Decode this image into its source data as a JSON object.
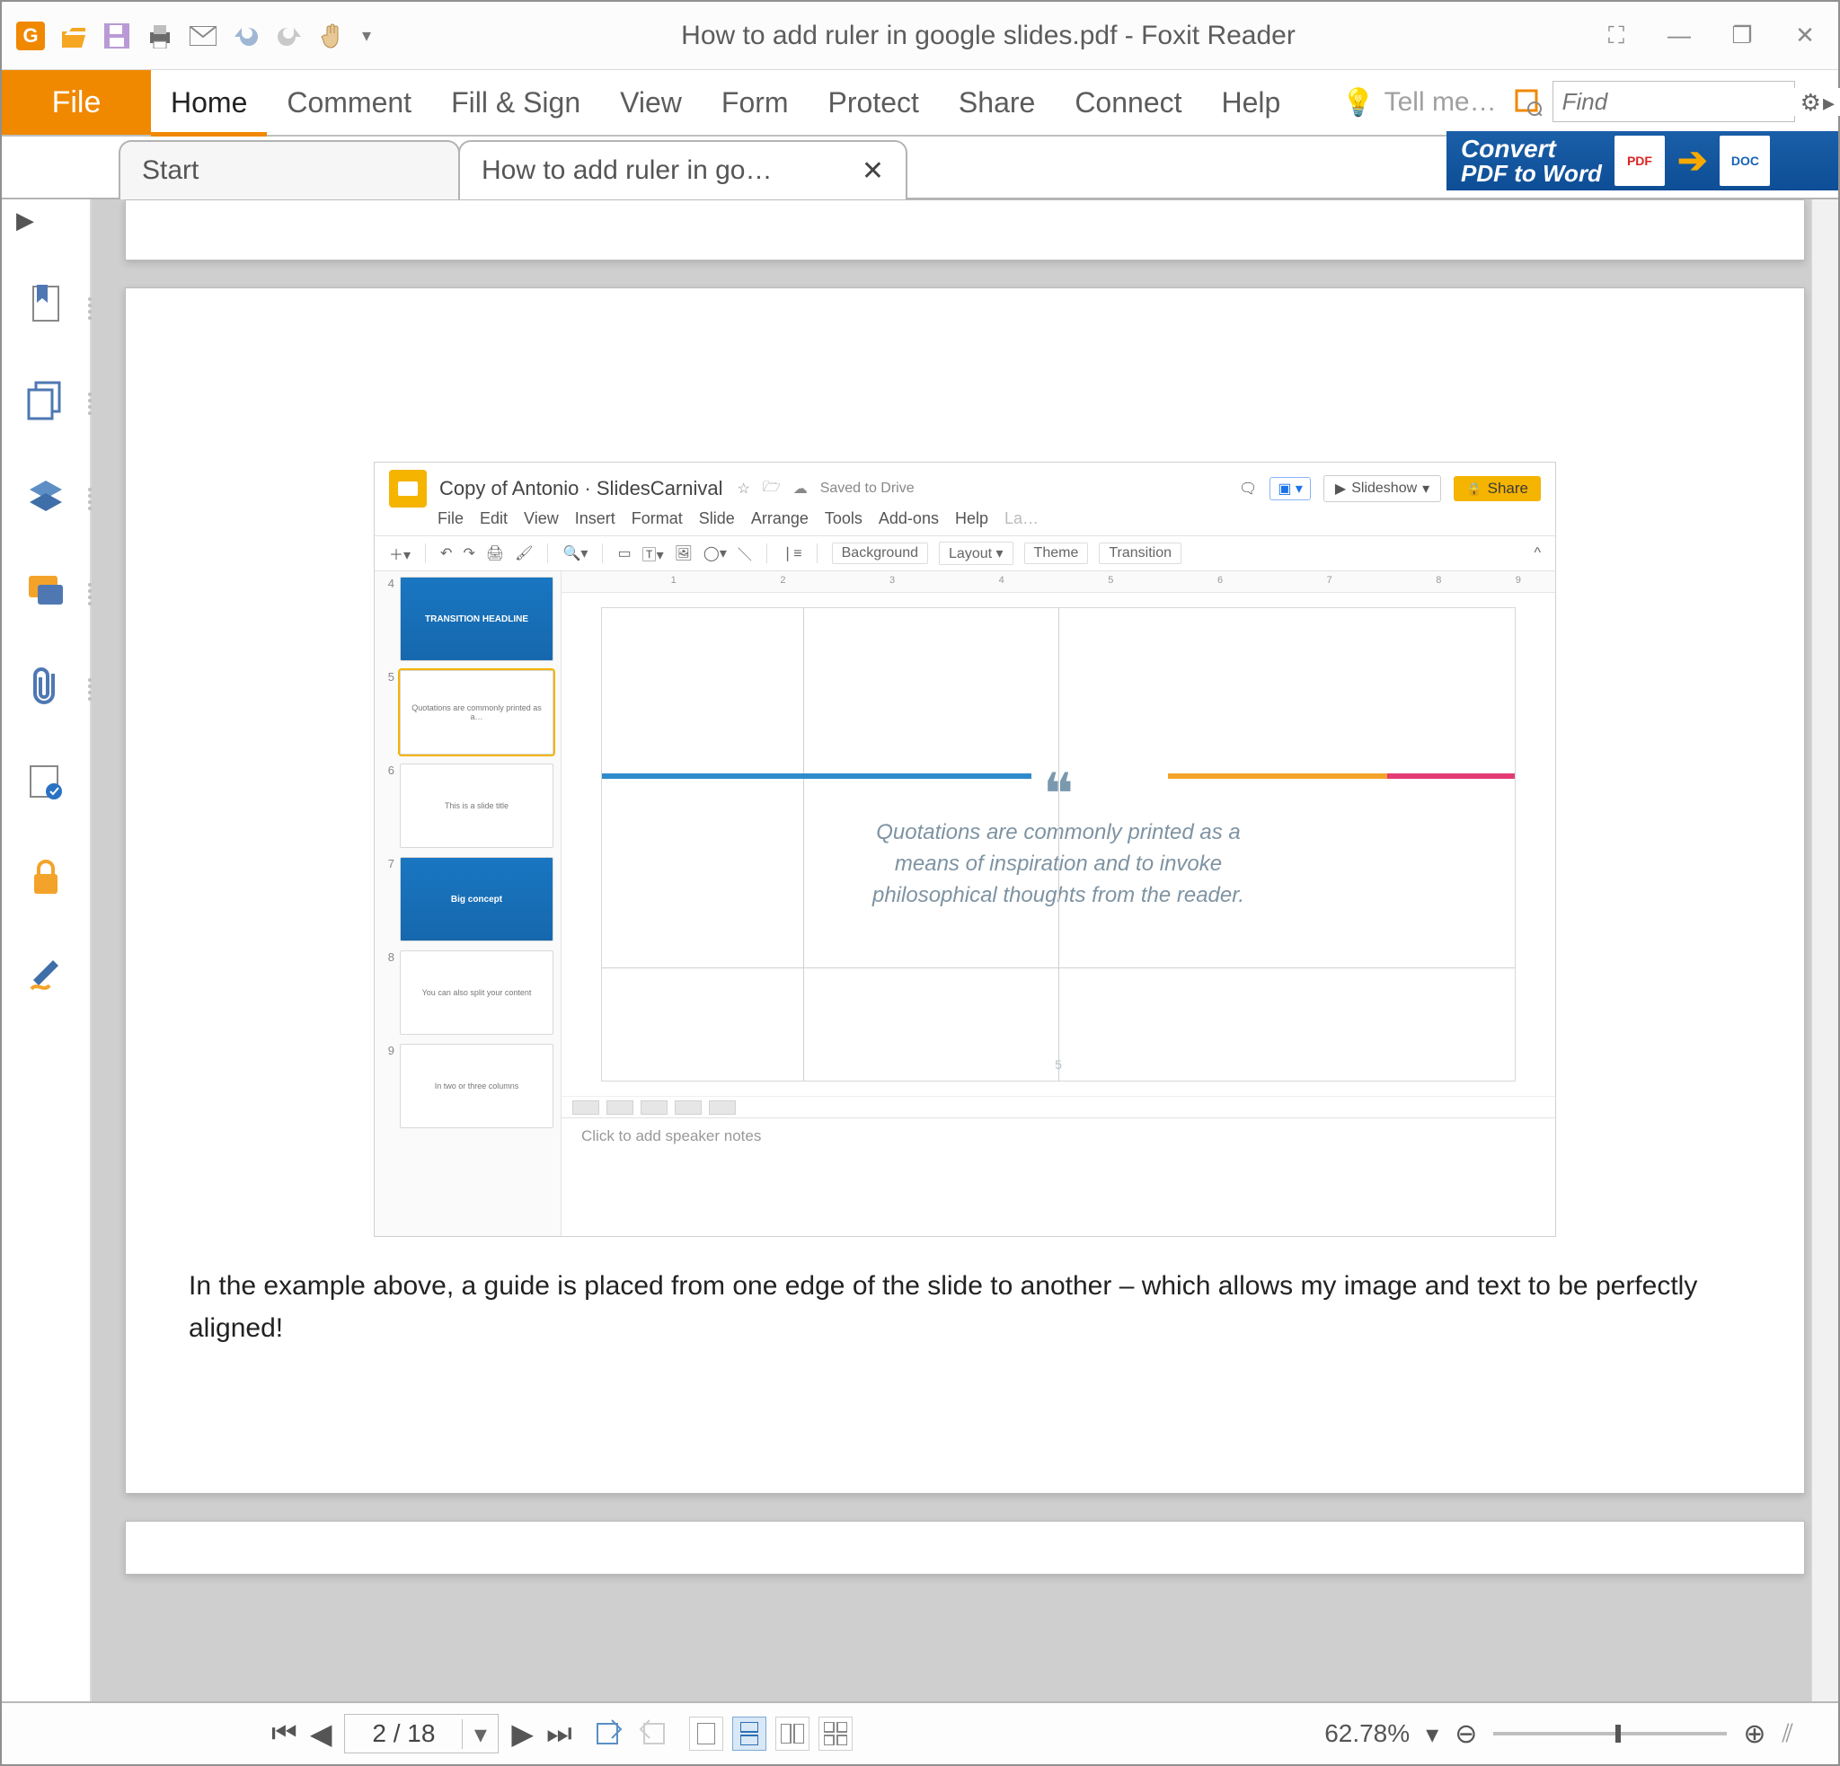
{
  "titlebar": {
    "title": "How to add ruler in google slides.pdf - Foxit Reader"
  },
  "ribbon": {
    "file": "File",
    "tabs": [
      "Home",
      "Comment",
      "Fill & Sign",
      "View",
      "Form",
      "Protect",
      "Share",
      "Connect",
      "Help"
    ],
    "tellme": "Tell me…",
    "find_placeholder": "Find"
  },
  "doctabs": {
    "start": "Start",
    "active": "How to add ruler in go…"
  },
  "banner": {
    "line1": "Convert",
    "line2": "PDF to Word",
    "pdf": "PDF",
    "doc": "DOC"
  },
  "doc": {
    "caption": "In the example above, a guide is placed from one edge of the slide to another – which allows my image and text to be perfectly aligned!",
    "gs": {
      "title": "Copy of Antonio · SlidesCarnival",
      "saved": "Saved to Drive",
      "menus": [
        "File",
        "Edit",
        "View",
        "Insert",
        "Format",
        "Slide",
        "Arrange",
        "Tools",
        "Add-ons",
        "Help",
        "La…"
      ],
      "toolbar": {
        "background": "Background",
        "layout": "Layout",
        "theme": "Theme",
        "transition": "Transition"
      },
      "slideshow": "Slideshow",
      "share": "Share",
      "thumbs": [
        {
          "n": "4",
          "cls": "blue",
          "label": "TRANSITION HEADLINE"
        },
        {
          "n": "5",
          "cls": "sel",
          "label": "Quotations are commonly printed as a…"
        },
        {
          "n": "6",
          "cls": "",
          "label": "This is a slide title"
        },
        {
          "n": "7",
          "cls": "blue",
          "label": "Big concept"
        },
        {
          "n": "8",
          "cls": "",
          "label": "You can also split your content"
        },
        {
          "n": "9",
          "cls": "",
          "label": "In two or three columns"
        }
      ],
      "ruler_marks": [
        "1",
        "2",
        "3",
        "4",
        "5",
        "6",
        "7",
        "8",
        "9"
      ],
      "quote_l1": "Quotations are commonly printed as a",
      "quote_l2": "means of inspiration and to invoke",
      "quote_l3": "philosophical thoughts from the reader.",
      "slide_num": "5",
      "notes": "Click to add speaker notes"
    }
  },
  "status": {
    "page": "2 / 18",
    "zoom": "62.78%"
  }
}
